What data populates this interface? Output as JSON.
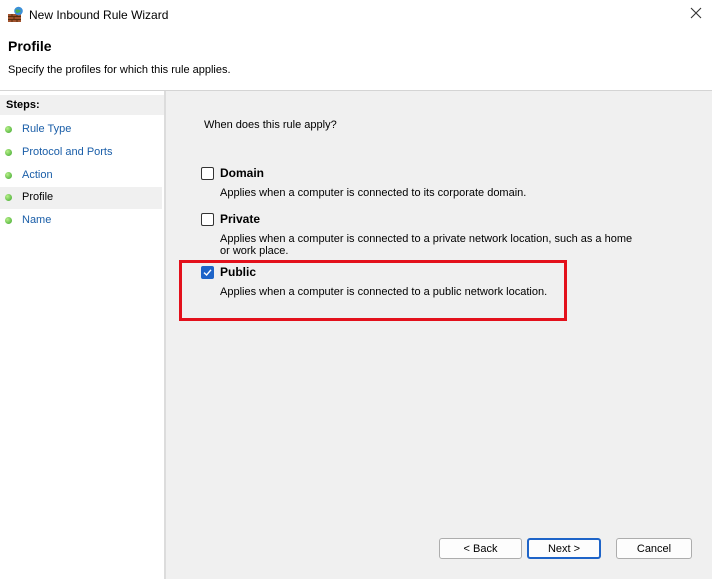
{
  "window": {
    "title": "New Inbound Rule Wizard",
    "close_icon": "close-icon",
    "app_icon": "firewall-icon"
  },
  "header": {
    "title": "Profile",
    "subtitle": "Specify the profiles for which this rule applies."
  },
  "sidebar": {
    "heading": "Steps:",
    "steps": [
      {
        "label": "Rule Type",
        "current": false
      },
      {
        "label": "Protocol and Ports",
        "current": false
      },
      {
        "label": "Action",
        "current": false
      },
      {
        "label": "Profile",
        "current": true
      },
      {
        "label": "Name",
        "current": false
      }
    ]
  },
  "main": {
    "question": "When does this rule apply?",
    "options": [
      {
        "label": "Domain",
        "description": "Applies when a computer is connected to its corporate domain.",
        "checked": false
      },
      {
        "label": "Private",
        "description": "Applies when a computer is connected to a private network location, such as a home or work place.",
        "checked": false
      },
      {
        "label": "Public",
        "description": "Applies when a computer is connected to a public network location.",
        "checked": true
      }
    ]
  },
  "buttons": {
    "back": "< Back",
    "next": "Next >",
    "cancel": "Cancel"
  },
  "colors": {
    "accent": "#1e64c8",
    "highlight_border": "#e3101b",
    "link": "#1a5ea8"
  }
}
